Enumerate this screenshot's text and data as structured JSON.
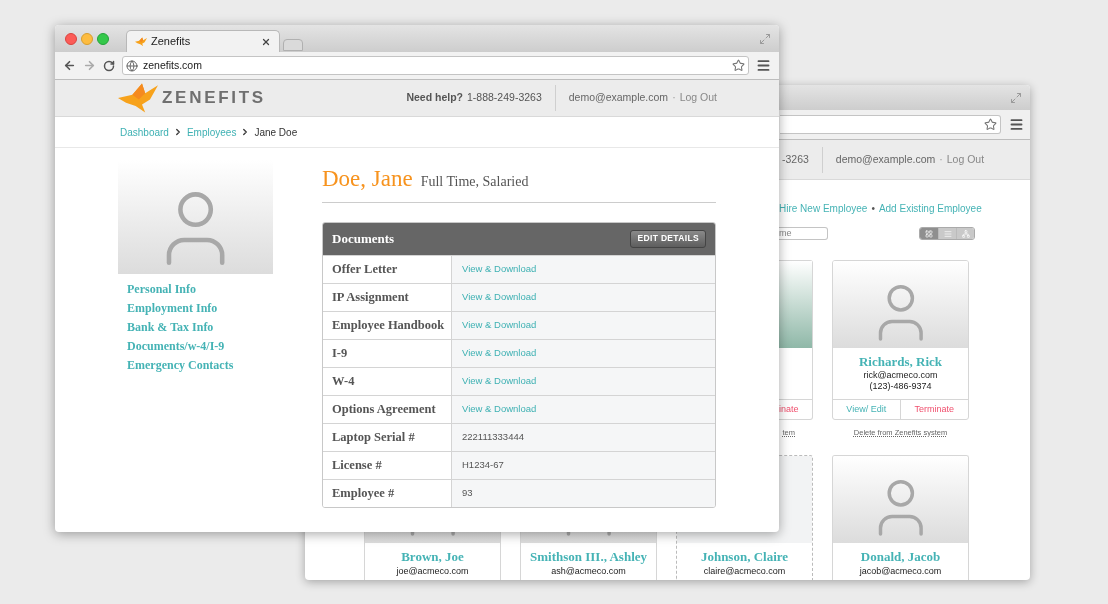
{
  "back_window": {
    "header": {
      "phone_fragment": "-3263",
      "email": "demo@example.com",
      "separator": "·",
      "logout": "Log Out"
    },
    "actions": {
      "hire": "Hire New Employee",
      "separator": "•",
      "add": "Add Existing Employee"
    },
    "search": {
      "placeholder": "me"
    },
    "view_toggle": [
      {
        "kind": "grid",
        "selected": true
      },
      {
        "kind": "list",
        "selected": false
      },
      {
        "kind": "tree",
        "selected": false
      }
    ],
    "top_cards": [
      {
        "kind": "fragment",
        "terminate": "inate",
        "note": "tem"
      },
      {
        "kind": "full",
        "name": "Richards, Rick",
        "email": "rick@acmeco.com",
        "phone": "(123)-486-9374",
        "view": "View/ Edit",
        "terminate": "Terminate",
        "note": "Delete from Zenefits system"
      }
    ],
    "bottom_cards": [
      {
        "kind": "photo",
        "name": "Brown, Joe",
        "email": "joe@acmeco.com"
      },
      {
        "kind": "photo",
        "name": "Smithson III., Ashley",
        "email": "ash@acmeco.com"
      },
      {
        "kind": "empty",
        "name": "Johnson, Claire",
        "email": "claire@acmeco.com"
      },
      {
        "kind": "photo",
        "name": "Donald, Jacob",
        "email": "jacob@acmeco.com"
      }
    ]
  },
  "front_window": {
    "tab": {
      "title": "Zenefits"
    },
    "address_bar": {
      "url": "zenefits.com"
    },
    "header": {
      "logo": "ZENEFITS",
      "help_label": "Need help?",
      "phone": "1-888-249-3263",
      "email": "demo@example.com",
      "separator": "·",
      "logout": "Log Out"
    },
    "breadcrumb": [
      {
        "label": "Dashboard",
        "current": false
      },
      {
        "label": "Employees",
        "current": false
      },
      {
        "label": "Jane Doe",
        "current": true
      }
    ],
    "sidebar_links": [
      "Personal Info",
      "Employment Info",
      "Bank & Tax Info",
      "Documents/w-4/I-9",
      "Emergency Contacts"
    ],
    "name": "Doe, Jane",
    "employment": "Full Time, Salaried",
    "documents": {
      "title": "Documents",
      "button": "EDIT DETAILS",
      "rows": [
        {
          "label": "Offer Letter",
          "value": "View & Download",
          "kind": "link"
        },
        {
          "label": "IP Assignment",
          "value": "View & Download",
          "kind": "link"
        },
        {
          "label": "Employee Handbook",
          "value": "View & Download",
          "kind": "link"
        },
        {
          "label": "I-9",
          "value": "View & Download",
          "kind": "link"
        },
        {
          "label": "W-4",
          "value": "View & Download",
          "kind": "link"
        },
        {
          "label": "Options Agreement",
          "value": "View & Download",
          "kind": "link"
        },
        {
          "label": "Laptop Serial #",
          "value": "222111333444",
          "kind": "text"
        },
        {
          "label": "License #",
          "value": "H1234-67",
          "kind": "text"
        },
        {
          "label": "Employee #",
          "value": "93",
          "kind": "text"
        }
      ]
    }
  }
}
